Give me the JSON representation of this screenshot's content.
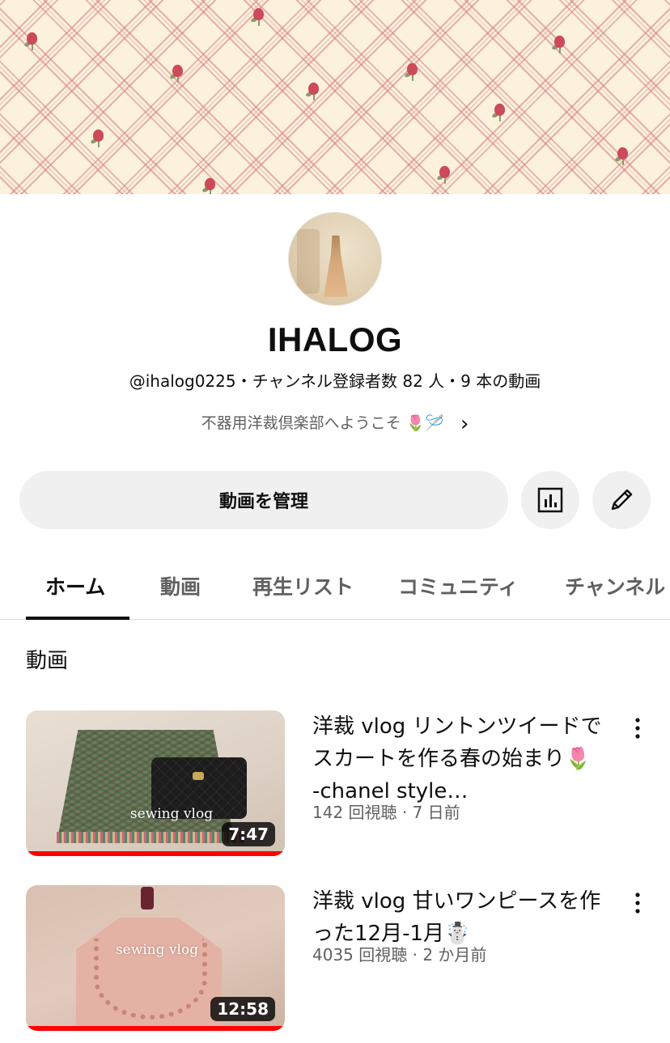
{
  "channel": {
    "name": "IHALOG",
    "meta": "@ihalog0225・チャンネル登録者数 82 人・9 本の動画",
    "description": "不器用洋裁倶楽部へようこそ 🌷🪡"
  },
  "actions": {
    "manage_label": "動画を管理"
  },
  "tabs": [
    {
      "label": "ホーム",
      "active": true
    },
    {
      "label": "動画",
      "active": false
    },
    {
      "label": "再生リスト",
      "active": false
    },
    {
      "label": "コミュニティ",
      "active": false
    },
    {
      "label": "チャンネル",
      "active": false
    }
  ],
  "section": {
    "title": "動画"
  },
  "videos": [
    {
      "title": "洋裁 vlog リントンツイードでスカートを作る春の始まり🌷 -chanel style…",
      "meta": "142 回視聴 · 7 日前",
      "duration": "7:47",
      "thumb_caption": "sewing vlog",
      "watched_fraction": 1.0
    },
    {
      "title": "洋裁 vlog 甘いワンピースを作った12月-1月☃️",
      "meta": "4035 回視聴 · 2 か月前",
      "duration": "12:58",
      "thumb_caption": "sewing vlog",
      "watched_fraction": 1.0
    }
  ],
  "colors": {
    "progress": "#ff0000",
    "tab_indicator": "#0f0f0f",
    "button_bg": "#f0f0f0"
  }
}
